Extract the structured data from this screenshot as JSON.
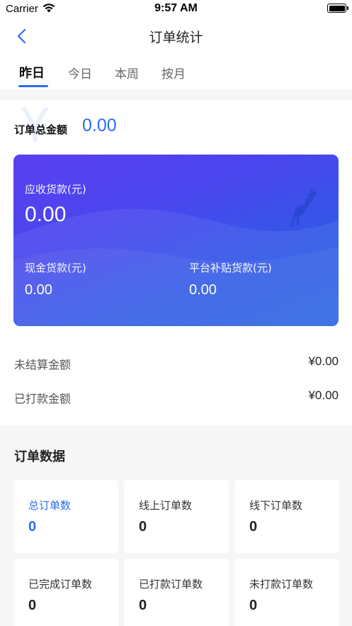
{
  "status_bar": {
    "carrier": "Carrier",
    "time": "9:57 AM"
  },
  "nav": {
    "title": "订单统计",
    "back_icon": "chevron-left-icon"
  },
  "tabs": [
    {
      "label": "昨日",
      "active": true
    },
    {
      "label": "今日",
      "active": false
    },
    {
      "label": "本周",
      "active": false
    },
    {
      "label": "按月",
      "active": false
    }
  ],
  "summary": {
    "watermark": "¥",
    "total_label": "订单总金额",
    "total_value": "0.00"
  },
  "card": {
    "receivable_label": "应收货款(元)",
    "receivable_value": "0.00",
    "cash_label": "现金货款(元)",
    "cash_value": "0.00",
    "subsidy_label": "平台补贴货款(元)",
    "subsidy_value": "0.00"
  },
  "amounts": [
    {
      "label": "未结算金额",
      "value": "¥0.00"
    },
    {
      "label": "已打款金额",
      "value": "¥0.00"
    }
  ],
  "order_data": {
    "title": "订单数据",
    "stats": [
      {
        "label": "总订单数",
        "value": "0"
      },
      {
        "label": "线上订单数",
        "value": "0"
      },
      {
        "label": "线下订单数",
        "value": "0"
      },
      {
        "label": "已完成订单数",
        "value": "0"
      },
      {
        "label": "已打款订单数",
        "value": "0"
      },
      {
        "label": "未打款订单数",
        "value": "0"
      }
    ]
  },
  "colors": {
    "accent": "#2a6df4",
    "card_start": "#5a3ff0",
    "card_end": "#2662e2"
  }
}
